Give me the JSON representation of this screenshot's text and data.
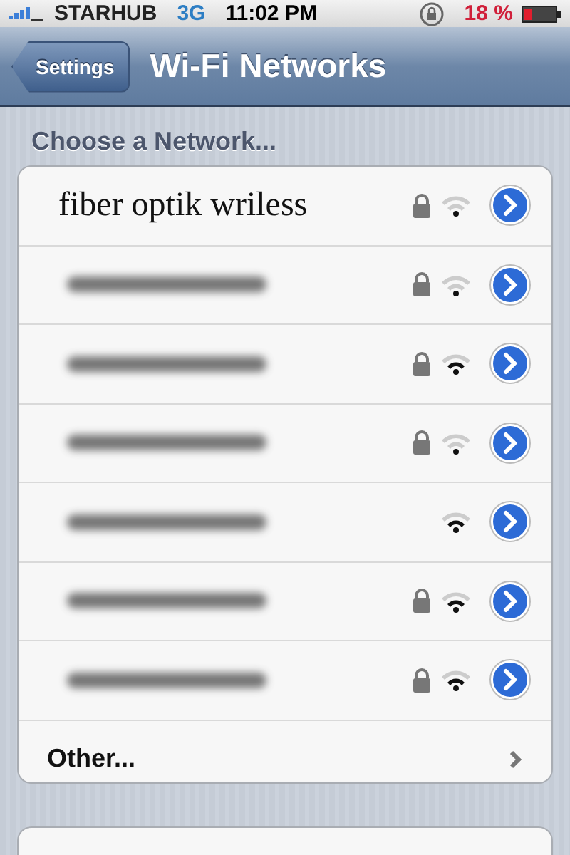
{
  "status_bar": {
    "carrier": "STARHUB",
    "network": "3G",
    "time": "11:02 PM",
    "battery": "18 %"
  },
  "nav_bar": {
    "back": "Settings",
    "title": "Wi-Fi Networks"
  },
  "section_header": "Choose a Network...",
  "networks": [
    {
      "kind": "named",
      "name": "fiber optik wriless",
      "locked": true,
      "strong": false
    },
    {
      "kind": "blurred",
      "locked": true,
      "strong": false
    },
    {
      "kind": "blurred",
      "locked": true,
      "strong": true
    },
    {
      "kind": "blurred",
      "locked": true,
      "strong": false
    },
    {
      "kind": "blurred",
      "locked": false,
      "strong": true
    },
    {
      "kind": "blurred",
      "locked": true,
      "strong": true
    },
    {
      "kind": "blurred",
      "locked": true,
      "strong": true
    }
  ],
  "other": "Other..."
}
